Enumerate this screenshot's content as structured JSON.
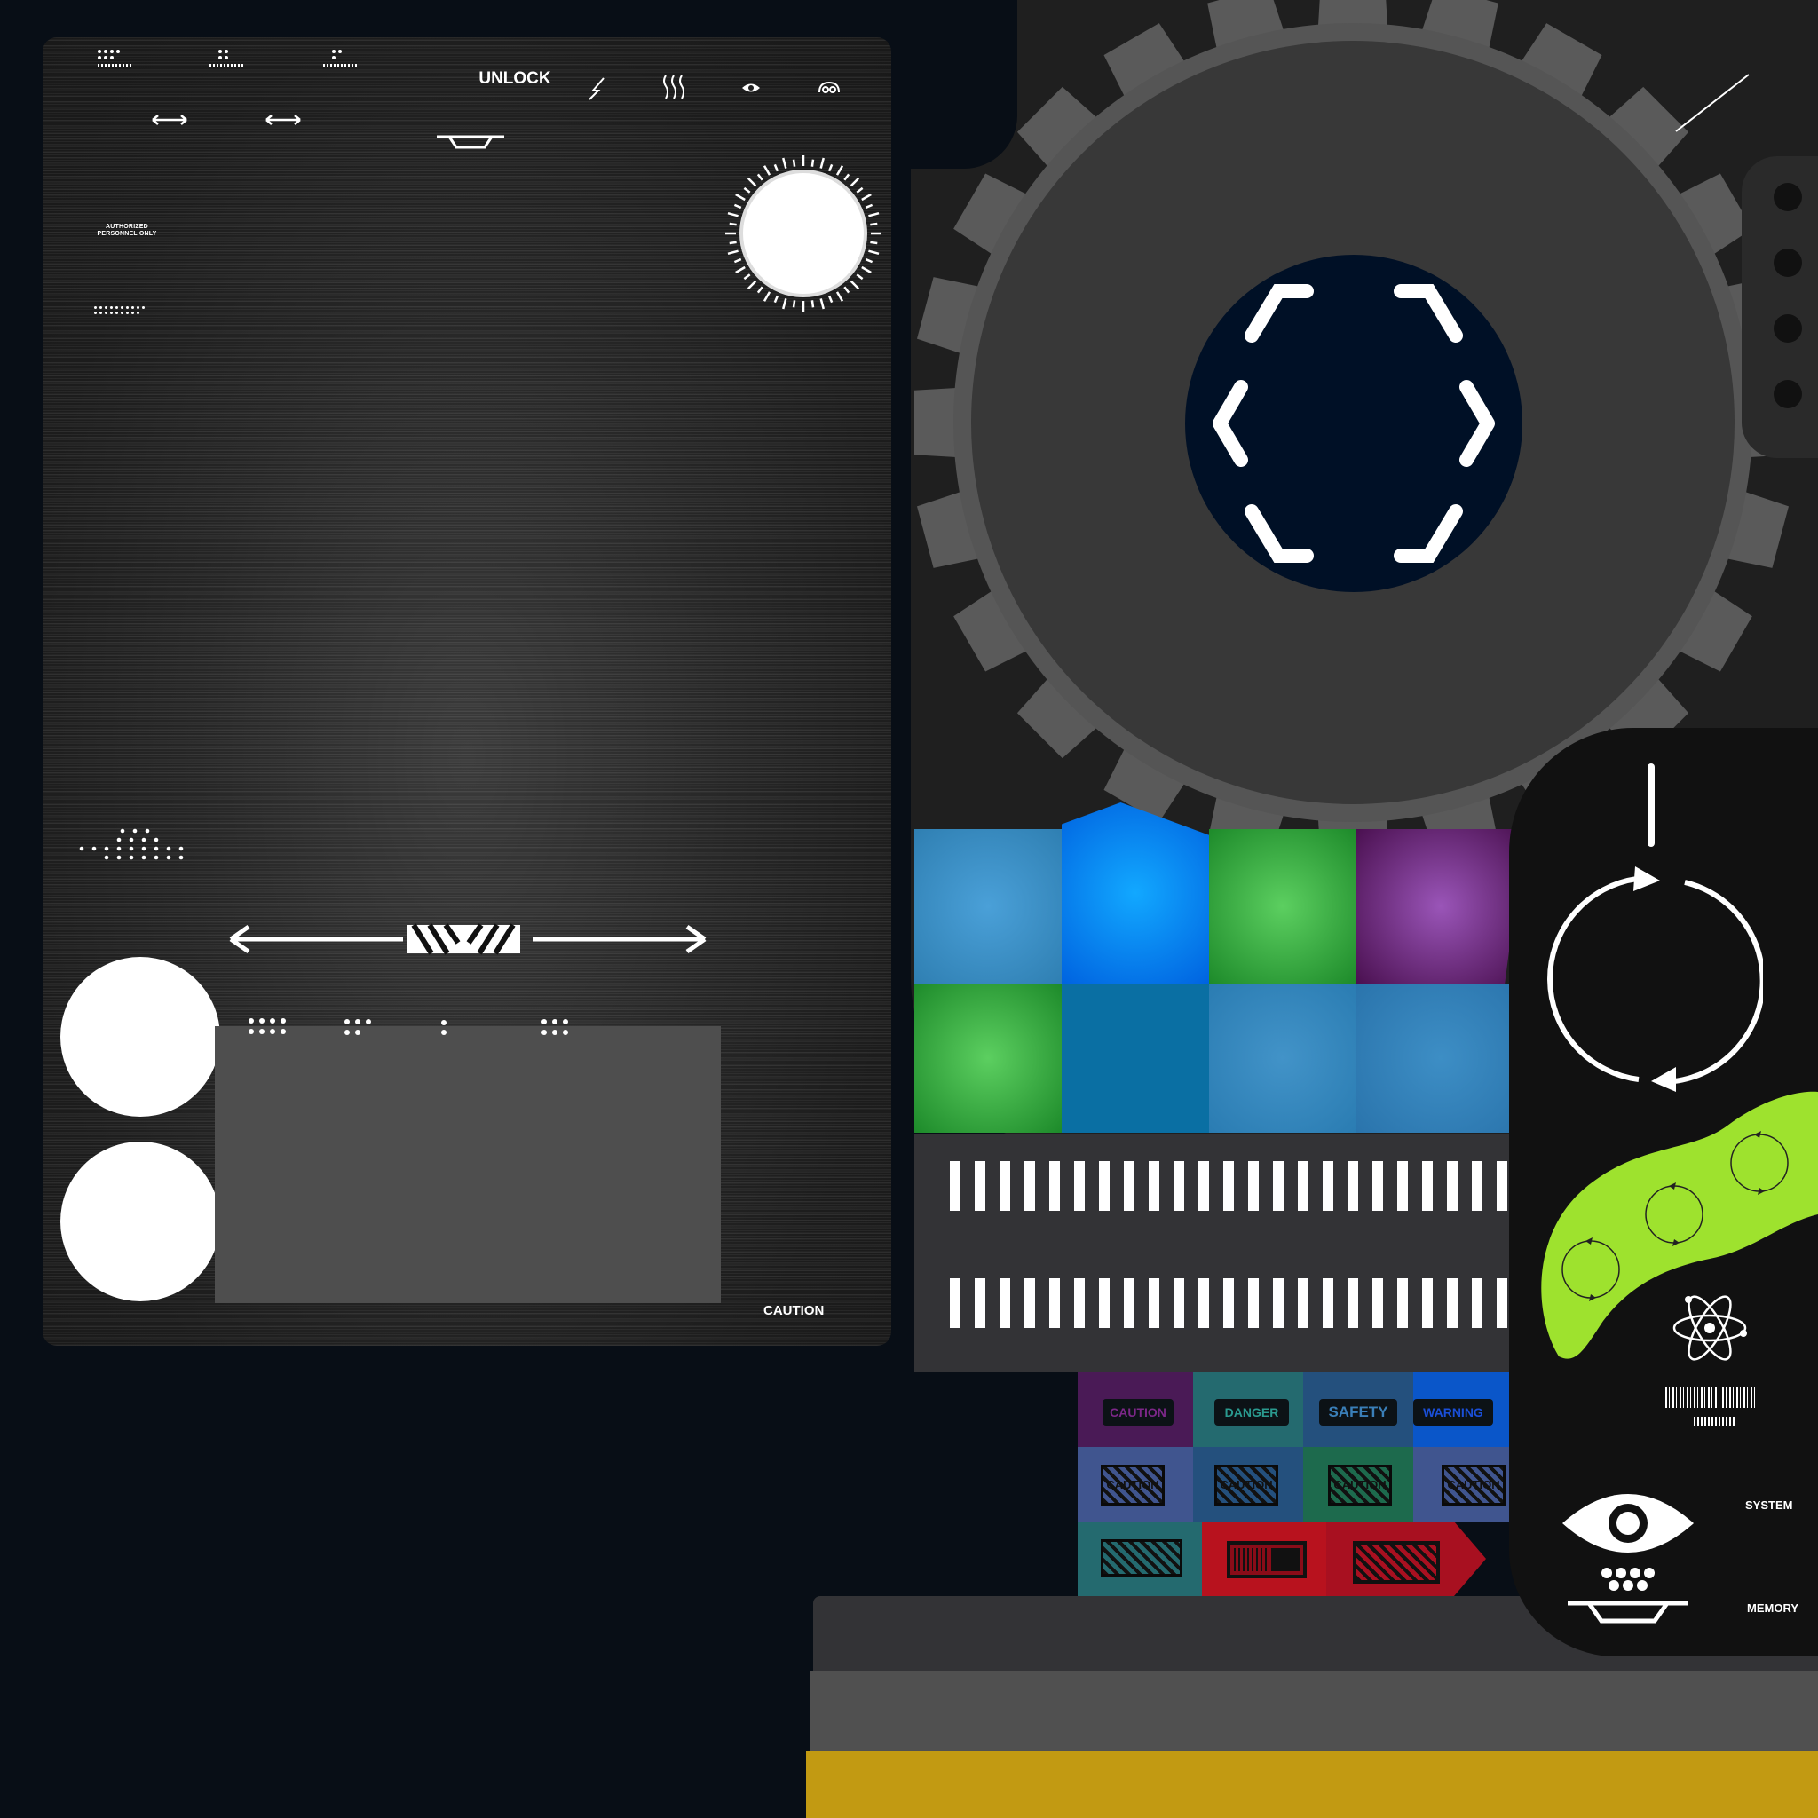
{
  "left_panel": {
    "unlock_label": "UNLOCK",
    "authorized_label_line1": "AUTHORIZED",
    "authorized_label_line2": "PERSONNEL ONLY",
    "caution_label": "CAUTION",
    "top_icons": [
      "lightning-icon",
      "heat-waves-icon",
      "eye-slit-icon",
      "swirl-icon"
    ]
  },
  "console": {
    "color_tiles_top": [
      "#3b8fcf",
      "#0a9dff",
      "#4bbd56",
      "#8a4da8"
    ],
    "color_tiles_bottom": [
      "#4bbd56",
      "#0a6fa3",
      "#3b8fcf",
      "#3b8fcf"
    ],
    "signs": [
      "CAUTION",
      "DANGER",
      "SAFETY",
      "WARNING"
    ],
    "caution_badges": [
      "CAUTION",
      "CAUTION",
      "CAUTION",
      "CAUTION"
    ],
    "system_label": "SYSTEM",
    "memory_label": "MEMORY",
    "accent_yellow": "#c29a12",
    "accent_green": "#9ee22e"
  }
}
